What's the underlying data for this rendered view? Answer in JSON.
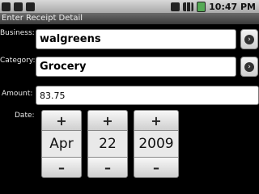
{
  "status_bar": {
    "time": "10:47 PM",
    "icons": [
      "notification-icon",
      "download-icon",
      "usb-icon",
      "sync-icon",
      "signal-icon",
      "battery-icon"
    ]
  },
  "title_bar": {
    "title": "Enter Receipt Detail"
  },
  "form": {
    "business_label": "Business:",
    "business_value": "walgreens",
    "category_label": "Category:",
    "category_value": "Grocery",
    "amount_label": "Amount:",
    "amount_value": "83.75",
    "date_label": "Date:"
  },
  "date_picker": {
    "month": "Apr",
    "day": "22",
    "year": "2009",
    "increment_symbol": "+",
    "decrement_symbol": "–"
  },
  "colors": {
    "background": "#000000",
    "field": "#ffffff",
    "title_bar": "#4a4a4a"
  }
}
